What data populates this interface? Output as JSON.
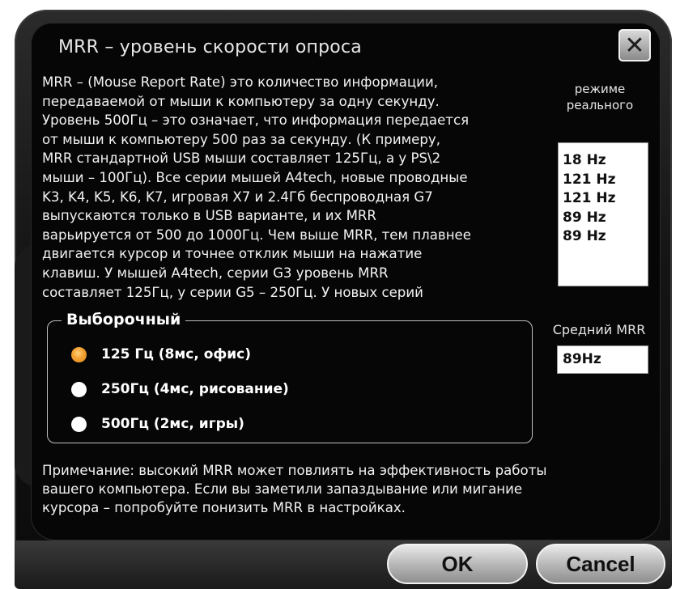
{
  "window": {
    "title": "MRR – уровень скорости опроса",
    "close_glyph": "✕"
  },
  "description": "MRR – (Mouse Report Rate) это количество информации,\nпередаваемой от мыши к компьютеру за одну секунду.\nУровень 500Гц – это означает, что информация передается\nот мыши к компьютеру 500 раз за секунду. (К примеру,\nMRR стандартной USB мыши составляет 125Гц, а у PS\\2\nмыши – 100Гц). Все серии мышей A4tech, новые проводные\nK3, K4, K5, K6, K7, игровая X7 и 2.4Гб беспроводная G7\nвыпускаются только в USB варианте, и их MRR\nварьируется от 500 до 1000Гц. Чем выше MRR, тем плавнее\nдвигается курсор и точнее отклик мыши на нажатие\nклавиш. У мышей A4tech, серии G3 уровень MRR\nсоставляет 125Гц, у серии G5 – 250Гц. У новых серий",
  "realtime": {
    "label": "режиме\nреального",
    "values": [
      "18 Hz",
      "121 Hz",
      "121 Hz",
      "89 Hz",
      "89 Hz"
    ]
  },
  "selection": {
    "group_label": "Выборочный",
    "options": [
      {
        "label": "125 Гц (8мс, офис)",
        "selected": true
      },
      {
        "label": "250Гц (4мс, рисование)",
        "selected": false
      },
      {
        "label": "500Гц (2мс, игры)",
        "selected": false
      }
    ]
  },
  "average": {
    "label": "Средний MRR",
    "value": "89Hz"
  },
  "note": "Примечание: высокий MRR может повлиять на эффективность работы\nвашего компьютера. Если вы заметили запаздывание или мигание\nкурсора – попробуйте понизить MRR в настройках.",
  "buttons": {
    "ok": "OK",
    "cancel": "Cancel"
  },
  "colors": {
    "selected_radio": "#f2a031",
    "background": "#060606",
    "text": "#f2f2f2"
  }
}
